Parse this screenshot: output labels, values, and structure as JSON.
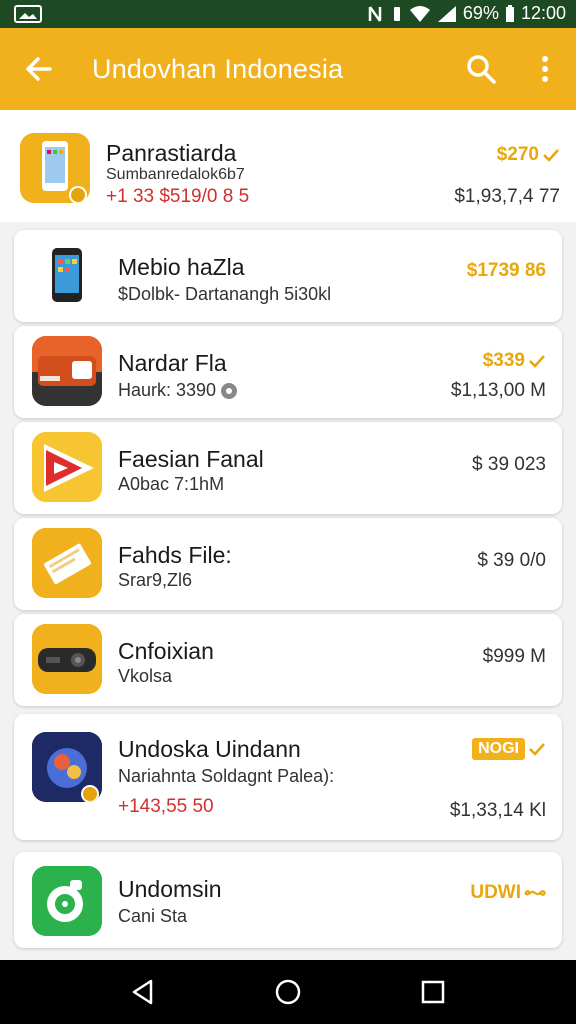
{
  "status_bar": {
    "battery": "69%",
    "time": "12:00"
  },
  "app_bar": {
    "title": "Undovhan Indonesia"
  },
  "items": [
    {
      "name": "Panrastiarda",
      "sub": "Sumbanredalok6b7",
      "sub2": "+1 33  $519/0 8 5",
      "price": "$270",
      "total": "$1,93,7,4 77"
    },
    {
      "name": "Mebio haZla",
      "sub": "$Dolbk- Dartanangh 5i30kl",
      "price": "$1739 86"
    },
    {
      "name": "Nardar Fla",
      "sub": "Haurk: 3390",
      "price": "$339",
      "total": "$1,13,00 M"
    },
    {
      "name": "Faesian Fanal",
      "sub": "A0bac 7:1hM",
      "price": "$ 39 023"
    },
    {
      "name": "Fahds File:",
      "sub": "Srar9,Zl6",
      "price": "$ 39 0/0"
    },
    {
      "name": "Cnfoixian",
      "sub": "Vkolsa",
      "price": "$999 M"
    },
    {
      "name": "Undoska Uindann",
      "sub": "Nariahnta Soldagnt Palea):",
      "sub2": "+143,55 50",
      "price": "NOGI",
      "total": "$1,33,14 Kl"
    },
    {
      "name": "Undomsin",
      "sub": "Cani Sta",
      "price": "UDWI"
    }
  ],
  "colors": {
    "accent": "#f0b11d",
    "status_bar": "#1d4a22",
    "red": "#d32f2f"
  }
}
